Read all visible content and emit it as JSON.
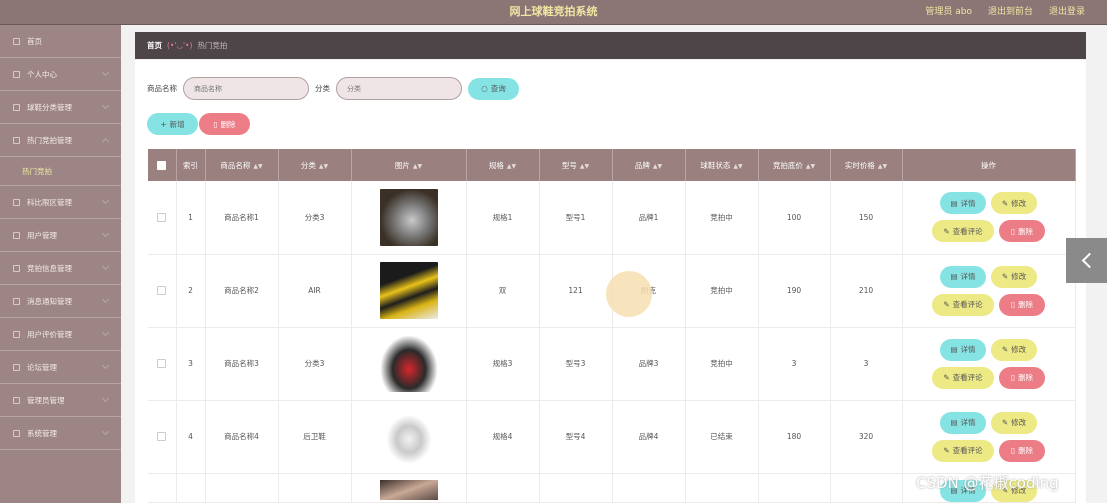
{
  "header": {
    "title": "网上球鞋竞拍系统",
    "admin_label": "管理员 abo",
    "back_label": "退出到前台",
    "logout_label": "退出登录"
  },
  "sidebar": {
    "items": [
      {
        "label": "首页"
      },
      {
        "label": "个人中心"
      },
      {
        "label": "球鞋分类管理"
      },
      {
        "label": "热门竞拍管理"
      },
      {
        "label": "热门竞拍",
        "sub": true
      },
      {
        "label": "科比限区管理"
      },
      {
        "label": "用户管理"
      },
      {
        "label": "竞拍信息管理"
      },
      {
        "label": "消息通知管理"
      },
      {
        "label": "用户评价管理"
      },
      {
        "label": "论坛管理"
      },
      {
        "label": "管理员管理"
      },
      {
        "label": "系统管理"
      }
    ]
  },
  "breadcrumb": {
    "home": "首页",
    "sep": "(•'◡'•)",
    "current": "热门竞拍"
  },
  "search": {
    "name_label": "商品名称",
    "name_placeholder": "商品名称",
    "category_label": "分类",
    "category_placeholder": "分类",
    "query_label": "查询"
  },
  "actions": {
    "add_label": "新增",
    "delete_label": "删除"
  },
  "table": {
    "headers": [
      "索引",
      "商品名称",
      "分类",
      "图片",
      "规格",
      "型号",
      "品牌",
      "球鞋状态",
      "竞拍底价",
      "实时价格",
      "操作"
    ],
    "rows": [
      {
        "index": "1",
        "name": "商品名称1",
        "category": "分类3",
        "spec": "规格1",
        "model": "型号1",
        "brand": "品牌1",
        "status": "竞拍中",
        "base_price": "100",
        "price": "150"
      },
      {
        "index": "2",
        "name": "商品名称2",
        "category": "AIR",
        "spec": "双",
        "model": "121",
        "brand": "耐克",
        "status": "竞拍中",
        "base_price": "190",
        "price": "210"
      },
      {
        "index": "3",
        "name": "商品名称3",
        "category": "分类3",
        "spec": "规格3",
        "model": "型号3",
        "brand": "品牌3",
        "status": "竞拍中",
        "base_price": "3",
        "price": "3"
      },
      {
        "index": "4",
        "name": "商品名称4",
        "category": "后卫鞋",
        "spec": "规格4",
        "model": "型号4",
        "brand": "品牌4",
        "status": "已结束",
        "base_price": "180",
        "price": "320"
      }
    ],
    "op_labels": {
      "detail": "详情",
      "edit": "修改",
      "review": "查看评论",
      "delete": "删除"
    }
  },
  "watermark": "CSDN @花椒coding"
}
